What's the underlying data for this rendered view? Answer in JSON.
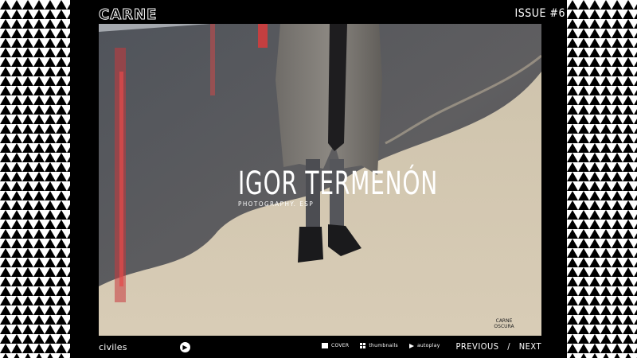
{
  "header": {
    "brand": "CARNE",
    "issue": "ISSUE #6"
  },
  "photo": {
    "title": "IGOR TERMENÓN",
    "subtitle": "PHOTOGRAPHY. ESP",
    "stamp": "CARNE OSCURA"
  },
  "footer": {
    "publisher": "civiles",
    "play_icon": "play-icon",
    "controls": {
      "cover": "COVER",
      "thumbnails": "thumbnails",
      "autoplay": "autoplay"
    },
    "previous": "PREVIOUS",
    "separator": "/",
    "next": "NEXT"
  }
}
